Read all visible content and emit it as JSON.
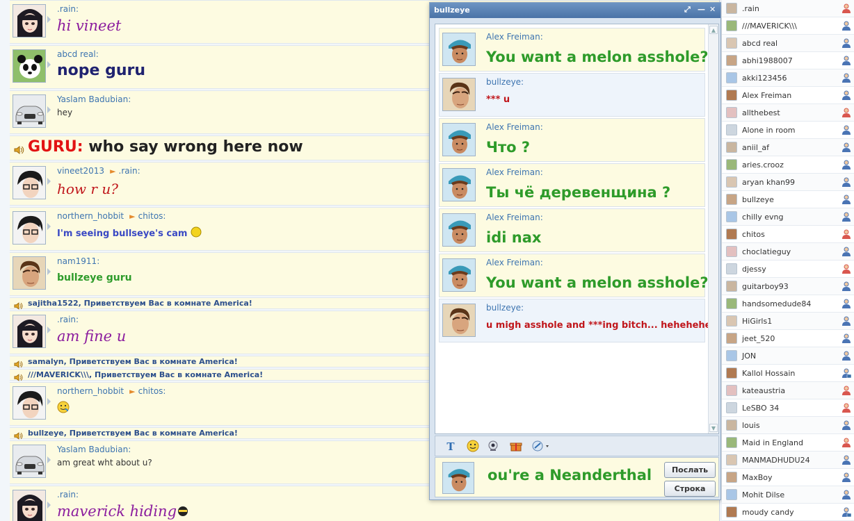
{
  "main_chat": {
    "messages": [
      {
        "type": "msg",
        "sender": ".rain:",
        "text": "hi vineet",
        "style": "purple-script"
      },
      {
        "type": "msg",
        "sender": "abcd real:",
        "text": "nope guru",
        "style": "navy-bold"
      },
      {
        "type": "msg",
        "sender": "Yaslam Badubian:",
        "text": "hey",
        "style": "plain"
      },
      {
        "type": "system",
        "prefix": "GURU:",
        "text": " who say wrong here now"
      },
      {
        "type": "msg",
        "sender": "vineet2013",
        "recipient": ".rain:",
        "text": "how r u?",
        "style": "red-script"
      },
      {
        "type": "msg",
        "sender": "northern_hobbit",
        "recipient": "chitos:",
        "text": "I'm seeing bullseye's cam",
        "style": "blue-bold"
      },
      {
        "type": "msg",
        "sender": "nam1911:",
        "text": "bullzeye guru",
        "style": "green"
      },
      {
        "type": "join",
        "text": "sajitha1522,  Приветствуем Вас в комнате  America!"
      },
      {
        "type": "msg",
        "sender": ".rain:",
        "text": "am fine u",
        "style": "purple-script"
      },
      {
        "type": "join",
        "text": "samalyn,  Приветствуем Вас в комнате  America!"
      },
      {
        "type": "join",
        "text": "///MAVERICK\\\\\\,  Приветствуем Вас в комнате  America!"
      },
      {
        "type": "msg",
        "sender": "northern_hobbit",
        "recipient": "chitos:",
        "text": "",
        "style": "emoji"
      },
      {
        "type": "join",
        "text": "bullzeye,  Приветствуем Вас в комнате  America!"
      },
      {
        "type": "msg",
        "sender": "Yaslam Badubian:",
        "text": "am great wht about u?",
        "style": "plain"
      },
      {
        "type": "msg",
        "sender": ".rain:",
        "text": "maverick hiding",
        "style": "purple-script"
      }
    ]
  },
  "private_window": {
    "title": "bullzeye",
    "messages": [
      {
        "sender": "Alex Freiman:",
        "text": "You want a melon asshole?",
        "color": "green",
        "bg": "yellow"
      },
      {
        "sender": "bullzeye:",
        "text": "*** u",
        "color": "red",
        "bg": "blue"
      },
      {
        "sender": "Alex Freiman:",
        "text": "Что ?",
        "color": "green",
        "bg": "yellow"
      },
      {
        "sender": "Alex Freiman:",
        "text": "Ты чё деревенщина ?",
        "color": "green",
        "bg": "yellow"
      },
      {
        "sender": "Alex Freiman:",
        "text": "idi nax",
        "color": "green",
        "bg": "yellow"
      },
      {
        "sender": "Alex Freiman:",
        "text": "You want a melon asshole?",
        "color": "green",
        "bg": "yellow"
      },
      {
        "sender": "bullzeye:",
        "text": "u migh asshole and ***ing bitch... hehehehe",
        "color": "red",
        "bg": "blue"
      }
    ],
    "input_text": "ou're a Neanderthal",
    "send_label": "Послать",
    "line_label": "Строка",
    "toolbar_icons": [
      "text-format-icon",
      "smiley-icon",
      "webcam-icon",
      "gift-icon",
      "draw-icon"
    ]
  },
  "users": [
    {
      "name": ".rain",
      "gender": "female"
    },
    {
      "name": "///MAVERICK\\\\\\",
      "gender": "male"
    },
    {
      "name": "abcd real",
      "gender": "male"
    },
    {
      "name": "abhi1988007",
      "gender": "male"
    },
    {
      "name": "akki123456",
      "gender": "male"
    },
    {
      "name": "Alex Freiman",
      "gender": "male"
    },
    {
      "name": "allthebest",
      "gender": "female"
    },
    {
      "name": "Alone in room",
      "gender": "male"
    },
    {
      "name": "aniil_af",
      "gender": "male"
    },
    {
      "name": "aries.crooz",
      "gender": "male"
    },
    {
      "name": "aryan khan99",
      "gender": "male"
    },
    {
      "name": "bullzeye",
      "gender": "male"
    },
    {
      "name": "chilly evng",
      "gender": "male"
    },
    {
      "name": "chitos",
      "gender": "female"
    },
    {
      "name": "choclatieguy",
      "gender": "male"
    },
    {
      "name": "djessy",
      "gender": "female"
    },
    {
      "name": "guitarboy93",
      "gender": "male"
    },
    {
      "name": "handsomedude84",
      "gender": "male"
    },
    {
      "name": "HiGirls1",
      "gender": "male"
    },
    {
      "name": "jeet_520",
      "gender": "male"
    },
    {
      "name": "JON",
      "gender": "male"
    },
    {
      "name": "Kallol Hossain",
      "gender": "male-cam"
    },
    {
      "name": "kateaustria",
      "gender": "female"
    },
    {
      "name": "LeSBO  34",
      "gender": "female"
    },
    {
      "name": "louis",
      "gender": "male"
    },
    {
      "name": "Maid in England",
      "gender": "female"
    },
    {
      "name": "MANMADHUDU24",
      "gender": "male"
    },
    {
      "name": "MaxBoy",
      "gender": "male"
    },
    {
      "name": "Mohit Dilse",
      "gender": "male"
    },
    {
      "name": "moudy candy",
      "gender": "male-cam"
    }
  ],
  "colors": {
    "green": "#2e9b2a",
    "red": "#c0161b",
    "purple": "#8b1c9e",
    "navy": "#1f2270",
    "blue": "#3a49c4",
    "guru": "#e21313"
  }
}
